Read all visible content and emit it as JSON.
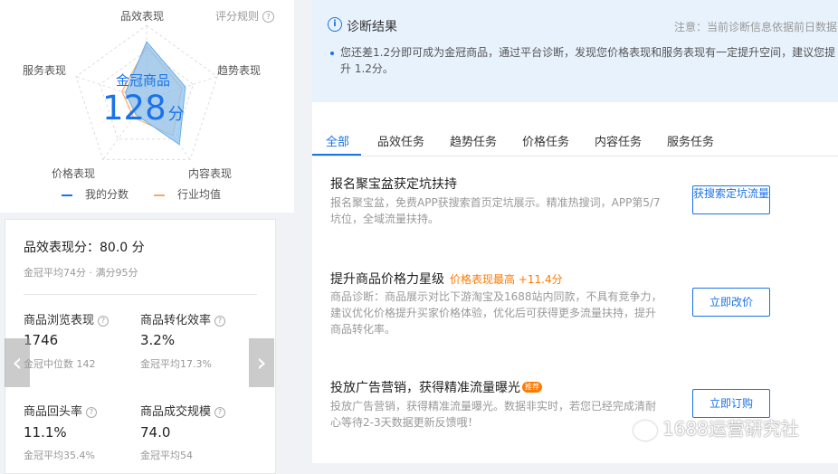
{
  "radar": {
    "axes": [
      "品效表现",
      "趋势表现",
      "内容表现",
      "价格表现",
      "服务表现"
    ],
    "rules_label": "评分规则",
    "rules_icon": "question-icon",
    "center_title": "金冠商品",
    "score": "128",
    "score_unit": "分",
    "my_scores": [
      0.78,
      0.55,
      0.75,
      0.25,
      0.3
    ],
    "avg_scores": [
      0.72,
      0.5,
      0.6,
      0.3,
      0.35
    ],
    "legend": [
      {
        "label": "我的分数",
        "color": "#1a73e8"
      },
      {
        "label": "行业均值",
        "color": "#f5a962"
      }
    ]
  },
  "card": {
    "title": "品效表现分：80.0 分",
    "subtitle": "金冠平均74分 · 满分95分",
    "metrics": [
      {
        "label": "商品浏览表现",
        "value": "1746",
        "sub": "金冠中位数 142"
      },
      {
        "label": "商品转化效率",
        "value": "3.2%",
        "sub": "金冠平均17.3%"
      },
      {
        "label": "商品回头率",
        "value": "11.1%",
        "sub": "金冠平均35.4%"
      },
      {
        "label": "商品成交规模",
        "value": "74.0",
        "sub": "金冠平均54"
      }
    ],
    "prev_icon": "chevron-left-icon",
    "next_icon": "chevron-right-icon"
  },
  "diagnosis": {
    "title": "诊断结果",
    "icon": "info-icon",
    "note": "注意：当前诊断信息依据前日数据",
    "text": "您还差1.2分即可成为金冠商品，通过平台诊断，发现您价格表现和服务表现有一定提升空间，建议您提升 1.2分。"
  },
  "tabs": [
    "全部",
    "品效任务",
    "趋势任务",
    "价格任务",
    "内容任务",
    "服务任务"
  ],
  "active_tab": "全部",
  "tasks": [
    {
      "title": "报名聚宝盆获定坑扶持",
      "highlight": "",
      "desc": "报名聚宝盆，免费APP获搜索首页定坑展示。精准热搜词，APP第5/7坑位，全域流量扶持。",
      "button": "获搜索定坑流量"
    },
    {
      "title": "提升商品价格力星级",
      "highlight": "价格表现最高 +11.4分",
      "desc": "商品诊断：商品展示对比下游淘宝及1688站内同款，不具有竞争力，建议优化价格提升买家价格体验，优化后可获得更多流量扶持，提升商品转化率。",
      "button": "立即改价"
    },
    {
      "title": "投放广告营销，获得精准流量曝光",
      "highlight": "",
      "tag": "推荐",
      "desc": "投放广告营销，获得精准流量曝光。数据非实时，若您已经完成清耐心等待2-3天数据更新反馈哦！",
      "button": "立即订购"
    }
  ],
  "watermark": "1688运营研究社"
}
